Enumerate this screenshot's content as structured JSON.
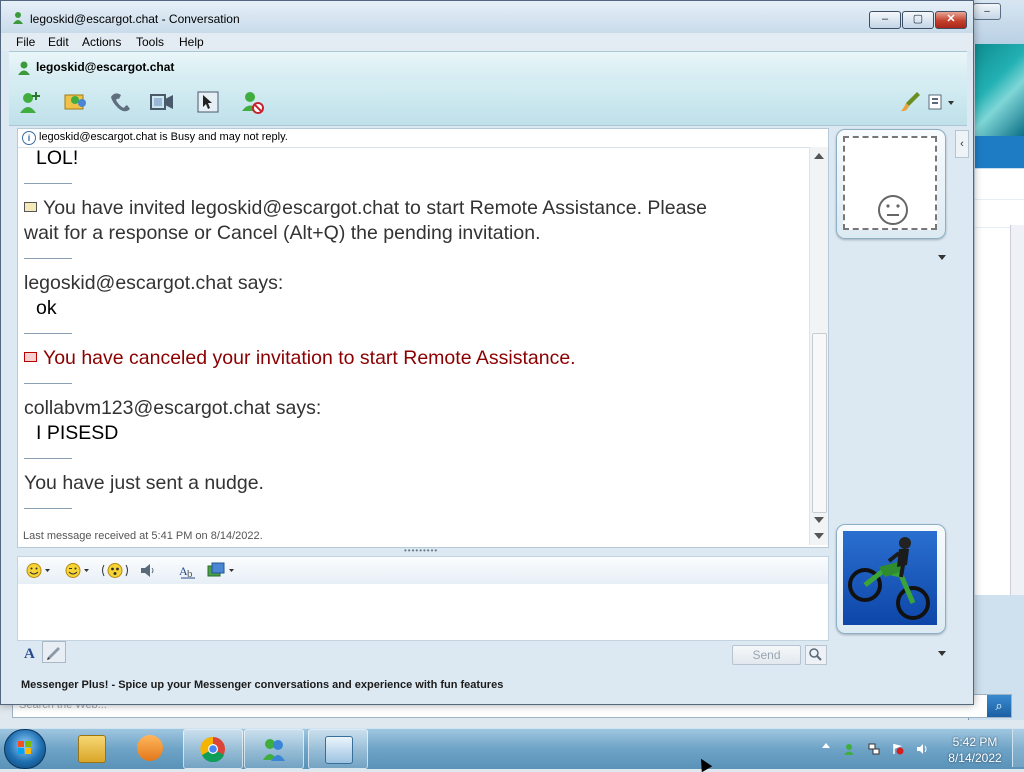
{
  "window": {
    "title": "legoskid@escargot.chat - Conversation",
    "minimize_glyph": "–",
    "maximize_glyph": "▢",
    "close_glyph": "✕"
  },
  "menu": [
    "File",
    "Edit",
    "Actions",
    "Tools",
    "Help"
  ],
  "contact_header": "legoskid@escargot.chat",
  "toolbar_icons": [
    "invite-contact-icon",
    "share-files-icon",
    "call-icon",
    "video-call-icon",
    "remote-assistance-icon",
    "block-contact-icon",
    "background-brush-icon",
    "display-options-icon"
  ],
  "status_notice": "legoskid@escargot.chat is Busy and may not reply.",
  "messages": {
    "m1": "LOL!",
    "m2_line1": "You have invited legoskid@escargot.chat to start Remote Assistance. Please",
    "m2_line2": "wait for a response or Cancel (Alt+Q) the pending invitation.",
    "m3_sender": "legoskid@escargot.chat says:",
    "m3_text": "ok",
    "m4": "You have canceled your invitation to start Remote Assistance.",
    "m5_sender": "collabvm123@escargot.chat says:",
    "m5_text": "I PISESD",
    "m6": "You have just sent a nudge."
  },
  "last_message": "Last message received at 5:41 PM on 8/14/2022.",
  "format_icons": [
    "emoticon-icon",
    "wink-icon",
    "nudge-icon",
    "voice-clip-icon",
    "font-style-icon",
    "background-icon"
  ],
  "input_value": "",
  "send_label": "Send",
  "plus_banner": "Messenger Plus! - Spice up your Messenger conversations and experience with fun features",
  "web_search_placeholder": "Search the Web...",
  "taskbar": {
    "apps": [
      "file-explorer-icon",
      "media-player-icon",
      "chrome-icon",
      "messenger-icon",
      "conversation-window-icon"
    ],
    "time": "5:42 PM",
    "date": "8/14/2022"
  },
  "colors": {
    "accent_text": "#8b0000",
    "message_gray": "#333333",
    "taskbar": "#6ea3c6"
  }
}
